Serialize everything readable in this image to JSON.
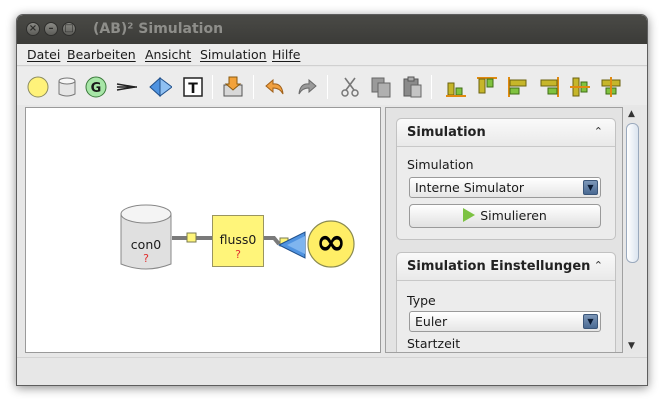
{
  "window": {
    "title": "(AB)² Simulation",
    "controls": {
      "close": "×",
      "minimize": "–",
      "maximize": "□"
    }
  },
  "menubar": {
    "items": [
      "Datei",
      "Bearbeiten",
      "Ansicht",
      "Simulation",
      "Hilfe"
    ]
  },
  "toolbar": {
    "icons": [
      "pool-icon",
      "store-icon",
      "global-constant-icon",
      "flow-arrow-icon",
      "sink-icon",
      "text-icon",
      "import-icon",
      "undo-icon",
      "redo-icon",
      "cut-icon",
      "copy-icon",
      "paste-icon",
      "align-bottom-icon",
      "align-top-icon",
      "align-left-icon",
      "align-right-icon",
      "align-center-vertical-icon",
      "align-center-horizontal-icon"
    ],
    "text_tool_label": "T"
  },
  "diagram": {
    "store": {
      "name": "con0",
      "value": "?"
    },
    "flow": {
      "name": "fluss0",
      "value": "?"
    },
    "sink": {
      "symbol": "∞"
    },
    "colors": {
      "store_fill": "#e0e0e0",
      "flow_fill": "#fff57a",
      "sink_fill": "#ffee66",
      "connector": "#777777",
      "unknown_value": "#e03030",
      "valve": "#4f93e0"
    }
  },
  "panel": {
    "simulation_group": {
      "title": "Simulation",
      "toggle": "⌃",
      "simulation_label": "Simulation",
      "simulator_value": "Interne Simulator",
      "run_button": "Simulieren"
    },
    "settings_group": {
      "title": "Simulation Einstellungen",
      "toggle": "⌃",
      "type_label": "Type",
      "type_value": "Euler",
      "start_label": "Startzeit",
      "start_value": ""
    }
  },
  "scrollbar": {
    "up": "▲",
    "down": "▼"
  }
}
